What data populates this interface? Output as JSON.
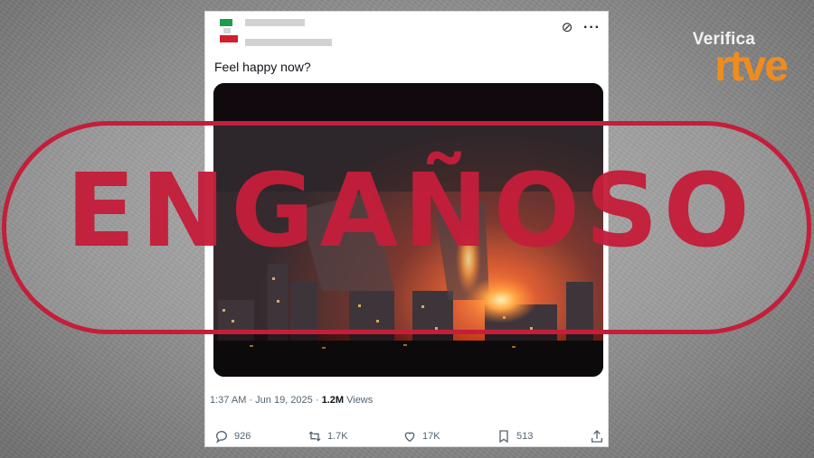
{
  "brand": {
    "verifica": "Verifica",
    "rtve": "rtve",
    "accent": "#f08c1e"
  },
  "tweet": {
    "text": "Feel happy now?",
    "time": "1:37 AM",
    "separator": "·",
    "date": "Jun 19, 2025",
    "views_count": "1.2M",
    "views_label": "Views",
    "actions": {
      "replies": "926",
      "reposts": "1.7K",
      "likes": "17K",
      "bookmarks": "513"
    },
    "image_description": "night city skyline with large fire"
  },
  "stamp": {
    "label": "ENGAÑOSO",
    "color": "#c41e3a"
  }
}
